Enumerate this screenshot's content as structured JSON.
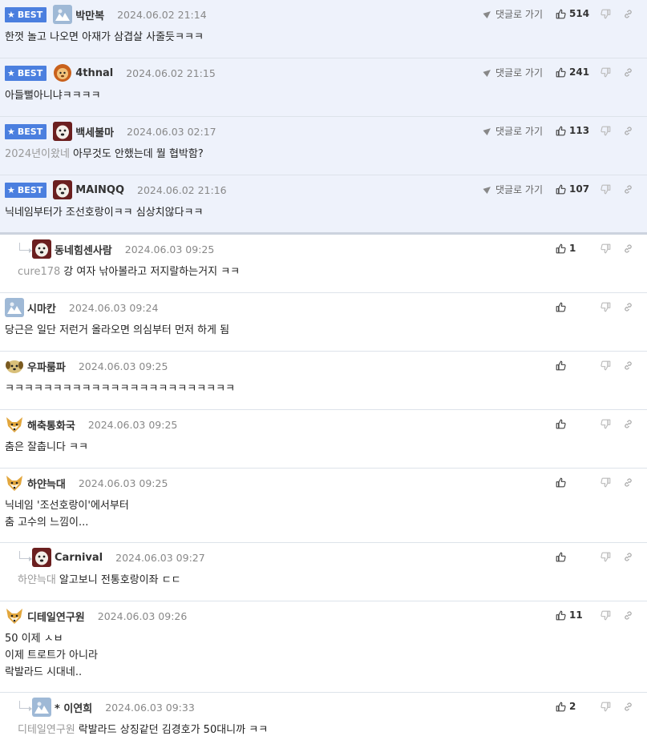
{
  "labels": {
    "best": "BEST",
    "goto_reply": "댓글로 가기"
  },
  "colors": {
    "best_bg": "#eef2fb",
    "badge": "#4b7fdf",
    "ref_text": "#999999"
  },
  "comments": [
    {
      "type": "best",
      "nick": "박만복",
      "date": "2024.06.02 21:14",
      "ref": "",
      "text": "한껏 놀고 나오면 아재가 삼겹살 사줄듯ㅋㅋㅋ",
      "likes": "514",
      "avatar": "ice-avatar"
    },
    {
      "type": "best",
      "nick": "4thnal",
      "date": "2024.06.02 21:15",
      "ref": "",
      "text": "아들뻘아니냐ㅋㅋㅋㅋ",
      "likes": "241",
      "avatar": "lion-avatar"
    },
    {
      "type": "best",
      "nick": "백세불마",
      "date": "2024.06.03 02:17",
      "ref": "2024년이왔네",
      "text": "아무것도 안했는데 뭘 협박함?",
      "likes": "113",
      "avatar": "dog-avatar"
    },
    {
      "type": "best",
      "nick": "MAINQQ",
      "date": "2024.06.02 21:16",
      "ref": "",
      "text": "닉네임부터가 조선호랑이ㅋㅋ 심상치않다ㅋㅋ",
      "likes": "107",
      "avatar": "dog-avatar"
    },
    {
      "type": "reply",
      "nick": "동네힘센사람",
      "date": "2024.06.03 09:25",
      "ref": "cure178",
      "text": "강 여자 낚아볼라고 저지랄하는거지 ㅋㅋ",
      "likes": "1",
      "avatar": "dog-avatar"
    },
    {
      "type": "normal",
      "nick": "시마칸",
      "date": "2024.06.03 09:24",
      "ref": "",
      "text": "당근은 일단 저런거 올라오면 의심부터 먼저 하게 됨",
      "likes": "",
      "avatar": "ice-avatar"
    },
    {
      "type": "normal",
      "nick": "우파룸파",
      "date": "2024.06.03 09:25",
      "ref": "",
      "text": "ㅋㅋㅋㅋㅋㅋㅋㅋㅋㅋㅋㅋㅋㅋㅋㅋㅋㅋㅋㅋㅋㅋㅋㅋ",
      "likes": "",
      "avatar": "pup-avatar"
    },
    {
      "type": "normal",
      "nick": "해축통화국",
      "date": "2024.06.03 09:25",
      "ref": "",
      "text": "춤은 잘춥니다 ㅋㅋ",
      "likes": "",
      "avatar": "fox-avatar"
    },
    {
      "type": "tall",
      "nick": "하얀늑대",
      "date": "2024.06.03 09:25",
      "ref": "",
      "text": "닉네임 '조선호랑이'에서부터\n춤 고수의 느낌이...",
      "likes": "",
      "avatar": "fox-avatar"
    },
    {
      "type": "reply",
      "nick": "Carnival",
      "date": "2024.06.03 09:27",
      "ref": "하얀늑대",
      "text": "알고보니 전통호랑이좌 ㄷㄷ",
      "likes": "",
      "avatar": "dog-avatar"
    },
    {
      "type": "tall",
      "nick": "디테일연구원",
      "date": "2024.06.03 09:26",
      "ref": "",
      "text": "50 이제 ㅅㅂ\n이제 트로트가 아니라\n락발라드 시대네..",
      "likes": "11",
      "avatar": "fox-avatar"
    },
    {
      "type": "reply",
      "nick": "* 이연희",
      "date": "2024.06.03 09:33",
      "ref": "디테일연구원",
      "text": "락발라드 상징같던 김경호가 50대니까 ㅋㅋ",
      "likes": "2",
      "avatar": "ice-avatar"
    }
  ]
}
